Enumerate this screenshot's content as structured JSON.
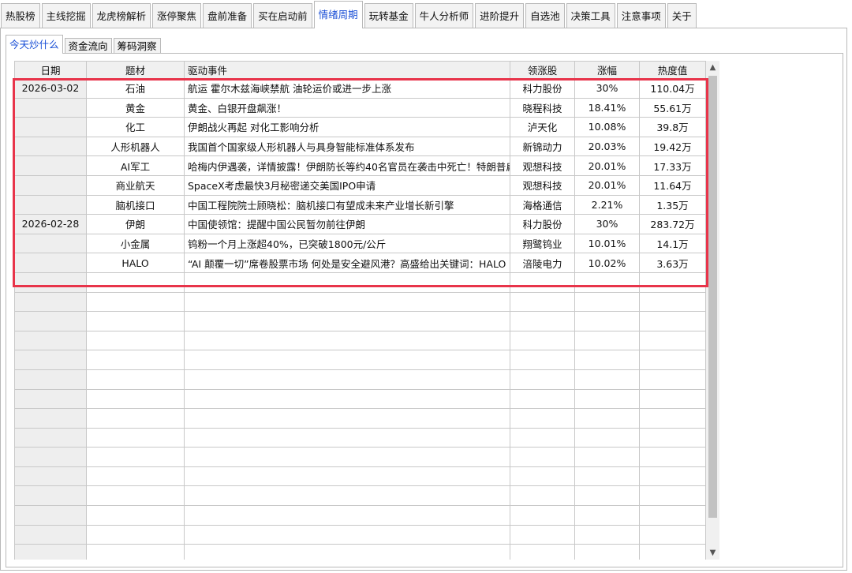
{
  "top_tabs": [
    {
      "label": "热股榜"
    },
    {
      "label": "主线挖掘"
    },
    {
      "label": "龙虎榜解析"
    },
    {
      "label": "涨停聚焦"
    },
    {
      "label": "盘前准备"
    },
    {
      "label": "买在启动前"
    },
    {
      "label": "情绪周期",
      "active": true
    },
    {
      "label": "玩转基金"
    },
    {
      "label": "牛人分析师"
    },
    {
      "label": "进阶提升"
    },
    {
      "label": "自选池"
    },
    {
      "label": "决策工具"
    },
    {
      "label": "注意事项"
    },
    {
      "label": "关于"
    }
  ],
  "sub_tabs": [
    {
      "label": "今天炒什么",
      "active": true
    },
    {
      "label": "资金流向"
    },
    {
      "label": "筹码洞察"
    }
  ],
  "table": {
    "headers": [
      "日期",
      "题材",
      "驱动事件",
      "领涨股",
      "涨幅",
      "热度值"
    ],
    "rows": [
      [
        "2026-03-02",
        "石油",
        "航运 霍尔木兹海峡禁航 油轮运价或进一步上涨",
        "科力股份",
        "30%",
        "110.04万"
      ],
      [
        "",
        "黄金",
        "黄金、白银开盘飙涨！",
        "晓程科技",
        "18.41%",
        "55.61万"
      ],
      [
        "",
        "化工",
        "伊朗战火再起 对化工影响分析",
        "泸天化",
        "10.08%",
        "39.8万"
      ],
      [
        "",
        "人形机器人",
        "我国首个国家级人形机器人与具身智能标准体系发布",
        "新锦动力",
        "20.03%",
        "19.42万"
      ],
      [
        "",
        "AI军工",
        "哈梅内伊遇袭，详情披露！伊朗防长等约40名官员在袭击中死亡！特朗普扁",
        "观想科技",
        "20.01%",
        "17.33万"
      ],
      [
        "",
        "商业航天",
        "SpaceX考虑最快3月秘密递交美国IPO申请",
        "观想科技",
        "20.01%",
        "11.64万"
      ],
      [
        "",
        "脑机接口",
        "中国工程院院士顾晓松：脑机接口有望成未来产业增长新引擎",
        "海格通信",
        "2.21%",
        "1.35万"
      ],
      [
        "2026-02-28",
        "伊朗",
        "中国使领馆：提醒中国公民暂勿前往伊朗",
        "科力股份",
        "30%",
        "283.72万"
      ],
      [
        "",
        "小金属",
        "钨粉一个月上涨超40%，已突破1800元/公斤",
        "翔鹭钨业",
        "10.01%",
        "14.1万"
      ],
      [
        "",
        "HALO",
        "“AI 颠覆一切”席卷股票市场 何处是安全避风港？高盛给出关键词：HALO",
        "涪陵电力",
        "10.02%",
        "3.63万"
      ]
    ],
    "empty_rows": 15
  },
  "scrollbar": {
    "up_icon": "▲",
    "down_icon": "▼"
  },
  "colors": {
    "active_tab_text": "#1a4fd6",
    "highlight": "#e8344a"
  }
}
